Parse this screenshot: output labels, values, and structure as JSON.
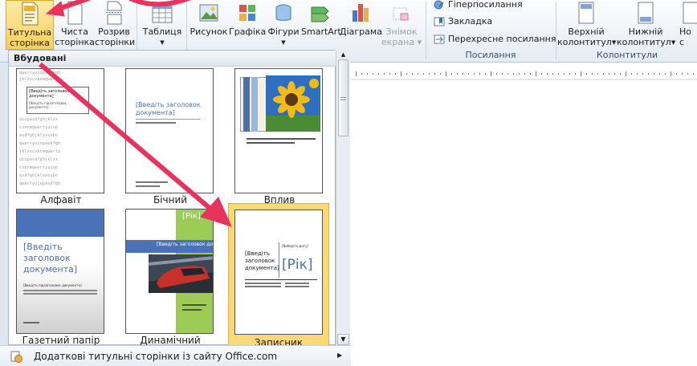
{
  "ribbon": {
    "cover_page": {
      "line1": "Титульна",
      "line2": "сторінка"
    },
    "blank_page": {
      "line1": "Чиста",
      "line2": "сторінка"
    },
    "page_break": {
      "line1": "Розрив",
      "line2": "сторінки"
    },
    "table": {
      "label": "Таблиця"
    },
    "picture": {
      "label": "Рисунок"
    },
    "clipart": {
      "label": "Графіка"
    },
    "shapes": {
      "label": "Фігури"
    },
    "smartart": {
      "label": "SmartArt"
    },
    "chart": {
      "label": "Діаграма"
    },
    "screenshot": {
      "line1": "Знімок",
      "line2": "екрана"
    },
    "hyperlink": {
      "label": "Гіперпосилання"
    },
    "bookmark": {
      "label": "Закладка"
    },
    "cross_reference": {
      "label": "Перехресне посилання"
    },
    "links_group": {
      "label": "Посилання"
    },
    "header": {
      "line1": "Верхній",
      "line2": "колонтитул"
    },
    "footer": {
      "line1": "Нижній",
      "line2": "колонтитул"
    },
    "page_number": {
      "line1": "Но",
      "line2": "с"
    },
    "header_footer_group": {
      "label": "Колонтитули"
    }
  },
  "gallery": {
    "section_title": "Вбудовані",
    "items": [
      {
        "caption": "Алфавіт"
      },
      {
        "caption": "Бічний",
        "title": "[Введіть заголовок документа]"
      },
      {
        "caption": "Вплив"
      },
      {
        "caption": "Газетний папір",
        "title": "[Введіть заголовок документа]",
        "subtitle": "[Введіть підзаголовок документа]"
      },
      {
        "caption": "Динамічний",
        "year": "[Рік]",
        "title": "[Введіть заголовок документа]"
      },
      {
        "caption": "Записник",
        "title": "[Введіть заголовок документа]",
        "year": "[Рік]",
        "date": "[Виберіть дату]"
      }
    ],
    "alpha_title": "[Введіть заголовок документа]",
    "alpha_subtitle": "[Введіть підзаголовок документа]",
    "alpha_text": [
      "qwertyuiopasdfgh",
      "jklzxcvbnmqwerty",
      "uiopasdfghjklzx",
      "cvbnmqwertyuiop",
      "asdfghjklzxcvbn"
    ],
    "more_link": "Додаткові титульні сторінки із сайту Office.com"
  },
  "colors": {
    "accent_arrow": "#e8335f",
    "selection": "#fbd976",
    "title_blue": "#4f6fa8"
  }
}
